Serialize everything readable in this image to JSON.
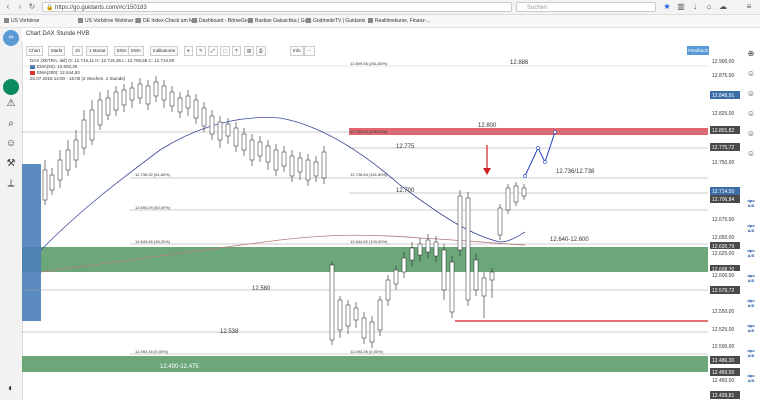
{
  "browser": {
    "url": "https://go.guidants.com/#c/150183",
    "search_placeholder": "Suchen"
  },
  "bookmarks": [
    "US Vorbörse",
    "US Vorbörse Webinar | ...",
    "DE Index-Check am Mi...",
    "Dashboard - BörseGo...",
    "Bastian Galuschka | Gu...",
    "GodmodeTV | Guidants",
    "Realtimekurse, Finanz-..."
  ],
  "chart": {
    "title": "Chart DAX Stunde HVB",
    "toolbar": [
      "Chart",
      "Markt",
      "1h",
      "1 Monat",
      "EMA",
      "Indikatoren",
      "",
      "",
      "",
      "",
      "",
      "",
      "",
      "Info"
    ],
    "feedback_label": "Feedback",
    "legend": [
      "DAX (XETRA, tief)  O: 12.715,11  H: 12.715,36  L: 12.706,55  C: 12.714,50",
      "EMA(50): 12.600,36",
      "EMA(200): 12.644,83",
      "25.07.2018 14:00 - 15:00 (2 Wochen, 1 Stunde)"
    ],
    "price_labels": [
      {
        "text": "12.900,00",
        "bg": "#ffffff"
      },
      {
        "text": "12.875,00",
        "bg": "#ffffff"
      },
      {
        "text": "12.848,91",
        "bg": "#3b6ea8"
      },
      {
        "text": "12.825,00",
        "bg": "#ffffff"
      },
      {
        "text": "12.801,82",
        "bg": "#4a4a4a"
      },
      {
        "text": "12.775,72",
        "bg": "#4a4a4a"
      },
      {
        "text": "12.750,00",
        "bg": "#ffffff"
      },
      {
        "text": "12.714,50",
        "bg": "#3b6ea8"
      },
      {
        "text": "12.706,84",
        "bg": "#4a4a4a"
      },
      {
        "text": "12.675,00",
        "bg": "#ffffff"
      },
      {
        "text": "12.650,00",
        "bg": "#ffffff"
      },
      {
        "text": "12.630,79",
        "bg": "#4a4a4a"
      },
      {
        "text": "12.625,00",
        "bg": "#ffffff"
      },
      {
        "text": "12.608,70",
        "bg": "#4a4a4a"
      },
      {
        "text": "12.600,00",
        "bg": "#ffffff"
      },
      {
        "text": "12.579,72",
        "bg": "#4a4a4a"
      },
      {
        "text": "12.550,00",
        "bg": "#ffffff"
      },
      {
        "text": "12.525,00",
        "bg": "#ffffff"
      },
      {
        "text": "12.500,00",
        "bg": "#ffffff"
      },
      {
        "text": "12.486,30",
        "bg": "#4a4a4a"
      },
      {
        "text": "12.469,50",
        "bg": "#4a4a4a"
      },
      {
        "text": "12.450,00",
        "bg": "#ffffff"
      },
      {
        "text": "12.439,81",
        "bg": "#4a4a4a"
      }
    ],
    "annotations": {
      "a12886": "12.886",
      "a12800": "12.800",
      "a12775": "12.775",
      "a12736": "12.736/12.738",
      "a12700": "12.700",
      "a12640": "12.640-12.600",
      "a12580": "12.580",
      "a12538": "12.538",
      "a12490": "12.490-12.475"
    },
    "fib_labels": [
      "12.809,56 (261,80%)",
      "12.793,54 (238,60%)",
      "12.736,52 (61,80%)",
      "12.738,64 (161,80%)",
      "12.690,09 (50,00%)",
      "12.643,66 (38,20%)",
      "12.644,52 (100,00%)",
      "12.493,16 (0,00%)",
      "12.493,26 (0,00%)"
    ],
    "colors": {
      "green_zone": "#2f7a3f",
      "red_zone": "#e0545e",
      "blue_zone": "#4a7fb8",
      "ema_blue": "#3c4a9a",
      "ema_red": "#b07a7a",
      "candle": "#222222",
      "arrow_red": "#d22222",
      "projection": "#2040c0"
    }
  }
}
